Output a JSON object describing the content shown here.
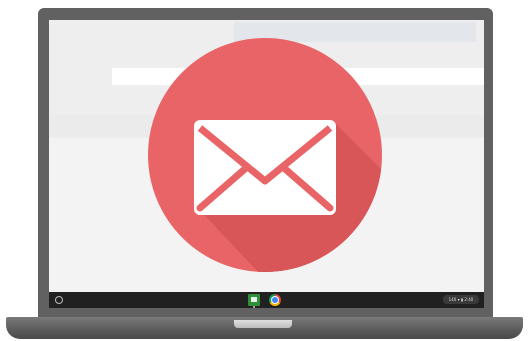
{
  "colors": {
    "lid": "#616161",
    "screen_bg": "#f3f3f3",
    "mail_circle": "#e96467",
    "mail_shadow": "#d85558",
    "envelope": "#ffffff",
    "shelf": "#212121"
  },
  "icons": {
    "hero": "mail-envelope-icon",
    "launcher": "launcher-circle-icon",
    "shelf_apps": [
      "classroom-icon",
      "chrome-icon"
    ],
    "tray": [
      "wifi-icon",
      "battery-icon"
    ]
  },
  "status_tray": {
    "text": "140 ▾ ▮ 2:40"
  }
}
